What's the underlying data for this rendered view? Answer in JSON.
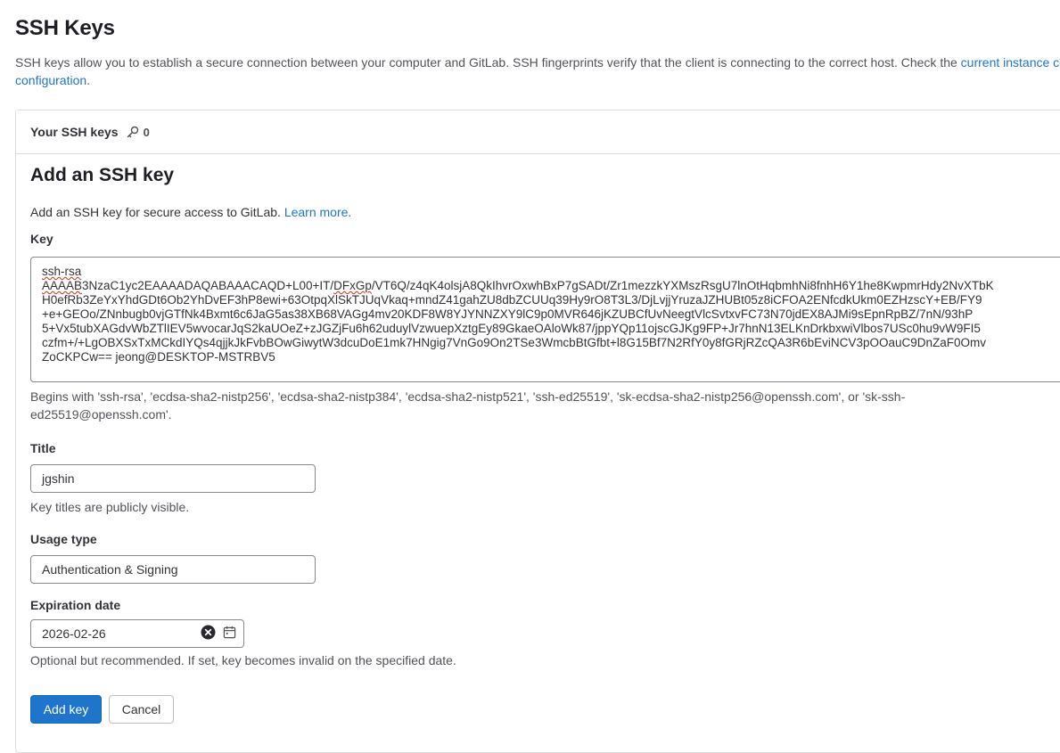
{
  "page": {
    "title": "SSH Keys",
    "description_text": "SSH keys allow you to establish a secure connection between your computer and GitLab. SSH fingerprints verify that the client is connecting to the correct host. Check the ",
    "description_link": "current instance configuration",
    "description_line2_link": "configuration",
    "description_end": "."
  },
  "keys_card": {
    "header_label": "Your SSH keys",
    "key_count": "0"
  },
  "form": {
    "title": "Add an SSH key",
    "subtitle_text": "Add an SSH key for secure access to GitLab. ",
    "subtitle_link": "Learn more.",
    "key_label": "Key",
    "key_value_lines": [
      "ssh-rsa",
      "AAAAB3NzaC1yc2EAAAADAQABAAACAQD+L00+IT/DFxGp/VT6Q/z4qK4olsjA8QkIhvrOxwhBxP7gSADt/Zr1mezzkYXMszRsgU7lnOtHqbmhNi8fnhH6Y1he8KwpmrHdy2NvXTbK",
      "H0efRb3ZeYxYhdGDt6Ob2YhDvEF3hP8ewi+63OtpqXlSkTJUqVkaq+mndZ41gahZU8dbZCUUq39Hy9rO8T3L3/DjLvjjYruzaJZHUBt05z8iCFOA2ENfcdkUkm0EZHzscY+EB/FY9",
      "+e+GEOo/ZNnbugb0vjGTfNk4Bxmt6c6JaG5as38XB68VAGg4mv20KDF8W8YJYNNZXY9lC9p0MVR646jKZUBCfUvNeegtVlcSvtxvFC73N70jdEX8AJMi9sEpnRpBZ/7nN/93hP",
      "5+Vx5tubXAGdvWbZTlIEV5wvocarJqS2kaUOeZ+zJGZjFu6h62uduylVzwuepXztgEy89GkaeOAloWk87/jppYQp11ojscGJKg9FP+Jr7hnN13ELKnDrkbxwiVlbos7USc0hu9vW9FI5",
      "czfm+/+LgOBXSxTxMCkdIYQs4qjjkJkFvbBOwGiwytW3dcuDoE1mk7HNgig7VnGo9On2TSe3WmcbBtGfbt+l8G15Bf7N2RfY0y8fGRjRZcQA3R6bEviNCV3pOOauC9DnZaF0Omv",
      "ZoCKPCw== jeong@DESKTOP-MSTRBV5"
    ],
    "key_help": [
      "Begins with 'ssh-rsa', 'ecdsa-sha2-nistp256', 'ecdsa-sha2-nistp384', 'ecdsa-sha2-nistp521', 'ssh-ed25519', 'sk-ecdsa-sha2-nistp256@openssh.com', or 'sk-ssh-",
      "ed25519@openssh.com'."
    ],
    "title_label": "Title",
    "title_value": "jgshin",
    "title_help": "Key titles are publicly visible.",
    "usage_label": "Usage type",
    "usage_value": "Authentication & Signing",
    "expiration_label": "Expiration date",
    "expiration_value": "2026-02-26",
    "expiration_help": "Optional but recommended. If set, key becomes invalid on the specified date.",
    "submit_label": "Add key",
    "cancel_label": "Cancel"
  },
  "colors": {
    "primary": "#1f75cb",
    "link": "#1f75cb",
    "border": "#dcdcde",
    "input_border": "#89888d",
    "spellcheck": "#dd2b0e"
  },
  "icons": [
    "key-icon",
    "clear-icon",
    "calendar-icon"
  ]
}
